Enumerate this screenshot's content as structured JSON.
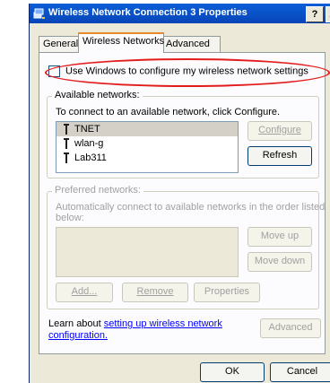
{
  "window": {
    "title": "Wireless Network Connection 3 Properties",
    "help": "?",
    "close": "X"
  },
  "tabs": [
    {
      "label": "General"
    },
    {
      "label": "Wireless Networks",
      "active": true
    },
    {
      "label": "Advanced"
    }
  ],
  "config_checkbox": {
    "label": "Use Windows to configure my wireless network settings",
    "checked": false
  },
  "available": {
    "legend": "Available networks:",
    "description": "To connect to an available network, click Configure.",
    "networks": [
      "TNET",
      "wlan-g",
      "Lab311"
    ],
    "configure_label": "Configure",
    "refresh_label": "Refresh"
  },
  "preferred": {
    "legend": "Preferred networks:",
    "description_line1": "Automatically connect to available networks in the order listed",
    "description_line2": "below:",
    "move_up_label": "Move up",
    "move_down_label": "Move down",
    "add_label": "Add...",
    "remove_label": "Remove",
    "properties_label": "Properties"
  },
  "learn": {
    "prefix": "Learn about ",
    "link_line1": "setting up wireless network",
    "link_line2": "configuration."
  },
  "advanced_label": "Advanced",
  "footer": {
    "ok_label": "OK",
    "cancel_label": "Cancel"
  },
  "colors": {
    "highlight_ellipse": "#e21c1c",
    "titlebar": "#0a5ed7",
    "active_tab_accent": "#e68b2c",
    "link": "#0000ff"
  }
}
